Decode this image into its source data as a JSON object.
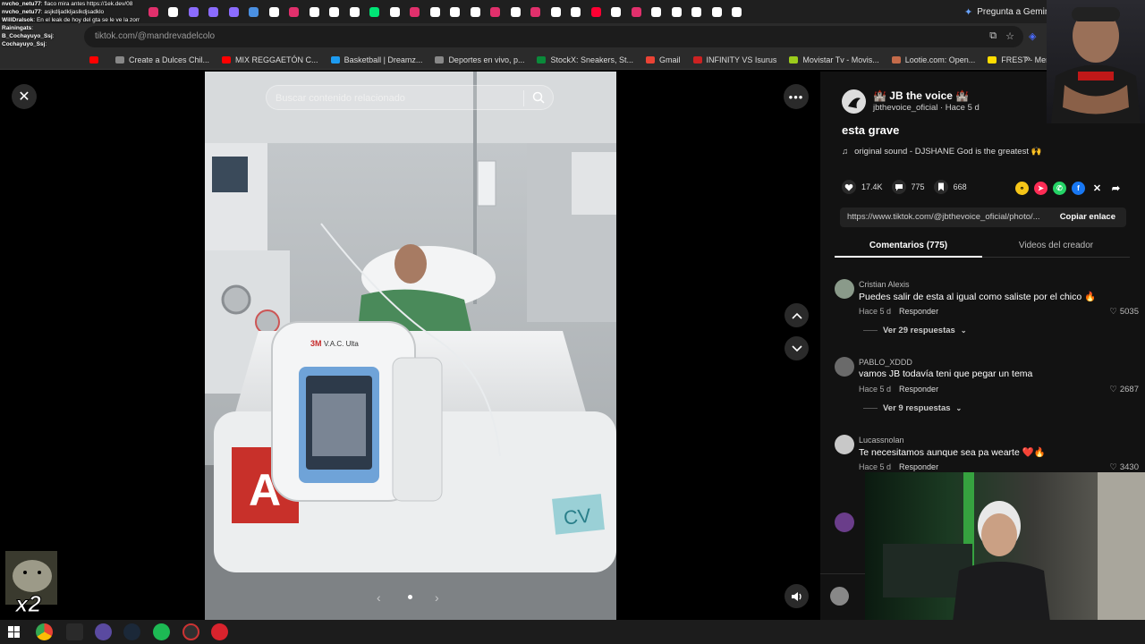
{
  "browser": {
    "gemini_label": "Pregunta a Gemini",
    "url": "tiktok.com/@mandrevadelcolo",
    "bookmarks": [
      {
        "label": "",
        "color": "#ff0000"
      },
      {
        "label": "Create a Dulces Chil...",
        "color": "#888888"
      },
      {
        "label": "MIX REGGAETÓN C...",
        "color": "#ff0000"
      },
      {
        "label": "Basketball | Dreamz...",
        "color": "#1d9bf0"
      },
      {
        "label": "Deportes en vivo, p...",
        "color": "#888888"
      },
      {
        "label": "StockX: Sneakers, St...",
        "color": "#0a8a3a"
      },
      {
        "label": "Gmail",
        "color": "#ea4335"
      },
      {
        "label": "INFINITY VS Isurus",
        "color": "#cc2222"
      },
      {
        "label": "Movistar Tv - Movis...",
        "color": "#9ccc1c"
      },
      {
        "label": "Lootie.com: Open...",
        "color": "#c46b4a"
      },
      {
        "label": "FREST - Mercado Sa...",
        "color": "#ffdd00"
      }
    ]
  },
  "chat": [
    {
      "user": "nvcho_netu77",
      "text": ": flaco mira antes https://1ek.dev/08"
    },
    {
      "user": "nvcho_netu77",
      "text": ": asjkdljadkljaslkdjsadklo"
    },
    {
      "user": "WillDralsok",
      "text": ": En el leak de hoy del gta se le ve la zorr"
    },
    {
      "user": "Rainingats",
      "text": ":"
    },
    {
      "user": "B_Cochayuyo_Ssj",
      "text": ":"
    },
    {
      "user": "Cochayuyo_Ssj",
      "text": ":"
    }
  ],
  "viewer": {
    "search_placeholder": "Buscar contenido relacionado",
    "photo_labels": {
      "device_brand": "3M",
      "device_model": "V.A.C. Ulta",
      "bed_letter": "A",
      "bed_tag": "CV"
    }
  },
  "post": {
    "creator_name": "🏰 JB the voice 🏰",
    "creator_sub": "jbthevoice_oficial · Hace 5 d",
    "title": "esta grave",
    "music": "original sound - DJSHANE God is the greatest 🙌",
    "likes": "17.4K",
    "comments_count": "775",
    "saves": "668",
    "link": "https://www.tiktok.com/@jbthevoice_oficial/photo/...",
    "copy_label": "Copiar enlace"
  },
  "tabs": {
    "comments": "Comentarios (775)",
    "creator_videos": "Videos del creador"
  },
  "comments": [
    {
      "user": "Cristian Alexis",
      "text": "Puedes salir de esta al igual como saliste por el chico 🔥",
      "time": "Hace 5 d",
      "reply": "Responder",
      "likes": "5035",
      "replies": "Ver 29 respuestas",
      "avatar_color": "#8a9a8a"
    },
    {
      "user": "PABLO_XDDD",
      "text": "vamos JB todavía teni que pegar un tema",
      "time": "Hace 5 d",
      "reply": "Responder",
      "likes": "2687",
      "replies": "Ver 9 respuestas",
      "avatar_color": "#6a6a6a"
    },
    {
      "user": "Lucassnolan",
      "text": "Te necesitamos aunque sea pa wearte ❤️🔥",
      "time": "Hace 5 d",
      "reply": "Responder",
      "likes": "3430",
      "replies": "",
      "avatar_color": "#c8c8c8"
    }
  ],
  "colors": {
    "panel_bg": "#121212",
    "accent_red": "#fe2c55",
    "link_bg": "#222222"
  }
}
